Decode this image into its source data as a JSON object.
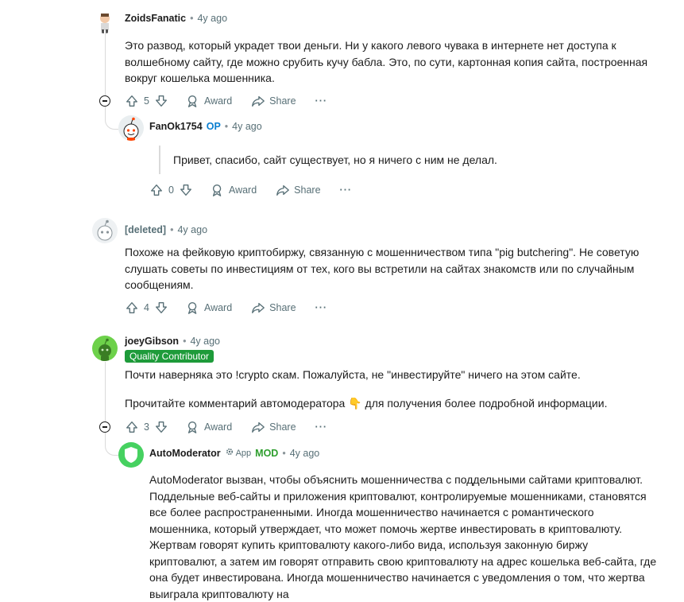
{
  "comments": [
    {
      "author": "ZoidsFanatic",
      "time": "4y ago",
      "text": "Это развод, который украдет твои деньги. Ни у какого левого чувака в интернете нет доступа к волшебному сайту, где можно срубить кучу бабла. Это, по сути, картонная копия сайта, построенная вокруг кошелька мошенника.",
      "votes": "5",
      "award_label": "Award",
      "share_label": "Share",
      "more_label": "···"
    },
    {
      "author": "FanOk1754",
      "op_label": "OP",
      "time": "4y ago",
      "text": "Привет, спасибо, сайт существует, но я ничего с ним не делал.",
      "votes": "0",
      "award_label": "Award",
      "share_label": "Share",
      "more_label": "···"
    },
    {
      "author": "[deleted]",
      "time": "4y ago",
      "text": "Похоже на фейковую криптобиржу, связанную с мошенничеством типа \"pig butchering\". Не советую слушать советы по инвестициям от тех, кого вы встретили на сайтах знакомств или по случайным сообщениям.",
      "votes": "4",
      "award_label": "Award",
      "share_label": "Share",
      "more_label": "···"
    },
    {
      "author": "joeyGibson",
      "time": "4y ago",
      "flair": "Quality Contributor",
      "text1": "Почти наверняка это !crypto скам. Пожалуйста, не \"инвестируйте\" ничего на этом сайте.",
      "text2_before": "Прочитайте комментарий автомодератора",
      "text2_emoji": "👇",
      "text2_after": "для получения более подробной информации.",
      "votes": "3",
      "award_label": "Award",
      "share_label": "Share",
      "more_label": "···"
    },
    {
      "author": "AutoModerator",
      "app_label": "App",
      "mod_label": "MOD",
      "time": "4y ago",
      "text": "AutoModerator вызван, чтобы объяснить мошенничества с поддельными сайтами криптовалют. Поддельные веб-сайты и приложения криптовалют, контролируемые мошенниками, становятся все более распространенными. Иногда мошенничество начинается с романтического мошенника, который утверждает, что может помочь жертве инвестировать в криптовалюту. Жертвам говорят купить криптовалюту какого-либо вида, используя законную биржу криптовалют, а затем им говорят отправить свою криптовалюту на адрес кошелька веб-сайта, где она будет инвестирована. Иногда мошенничество начинается с уведомления о том, что жертва выиграла криптовалюту на"
    }
  ],
  "dot": "•"
}
